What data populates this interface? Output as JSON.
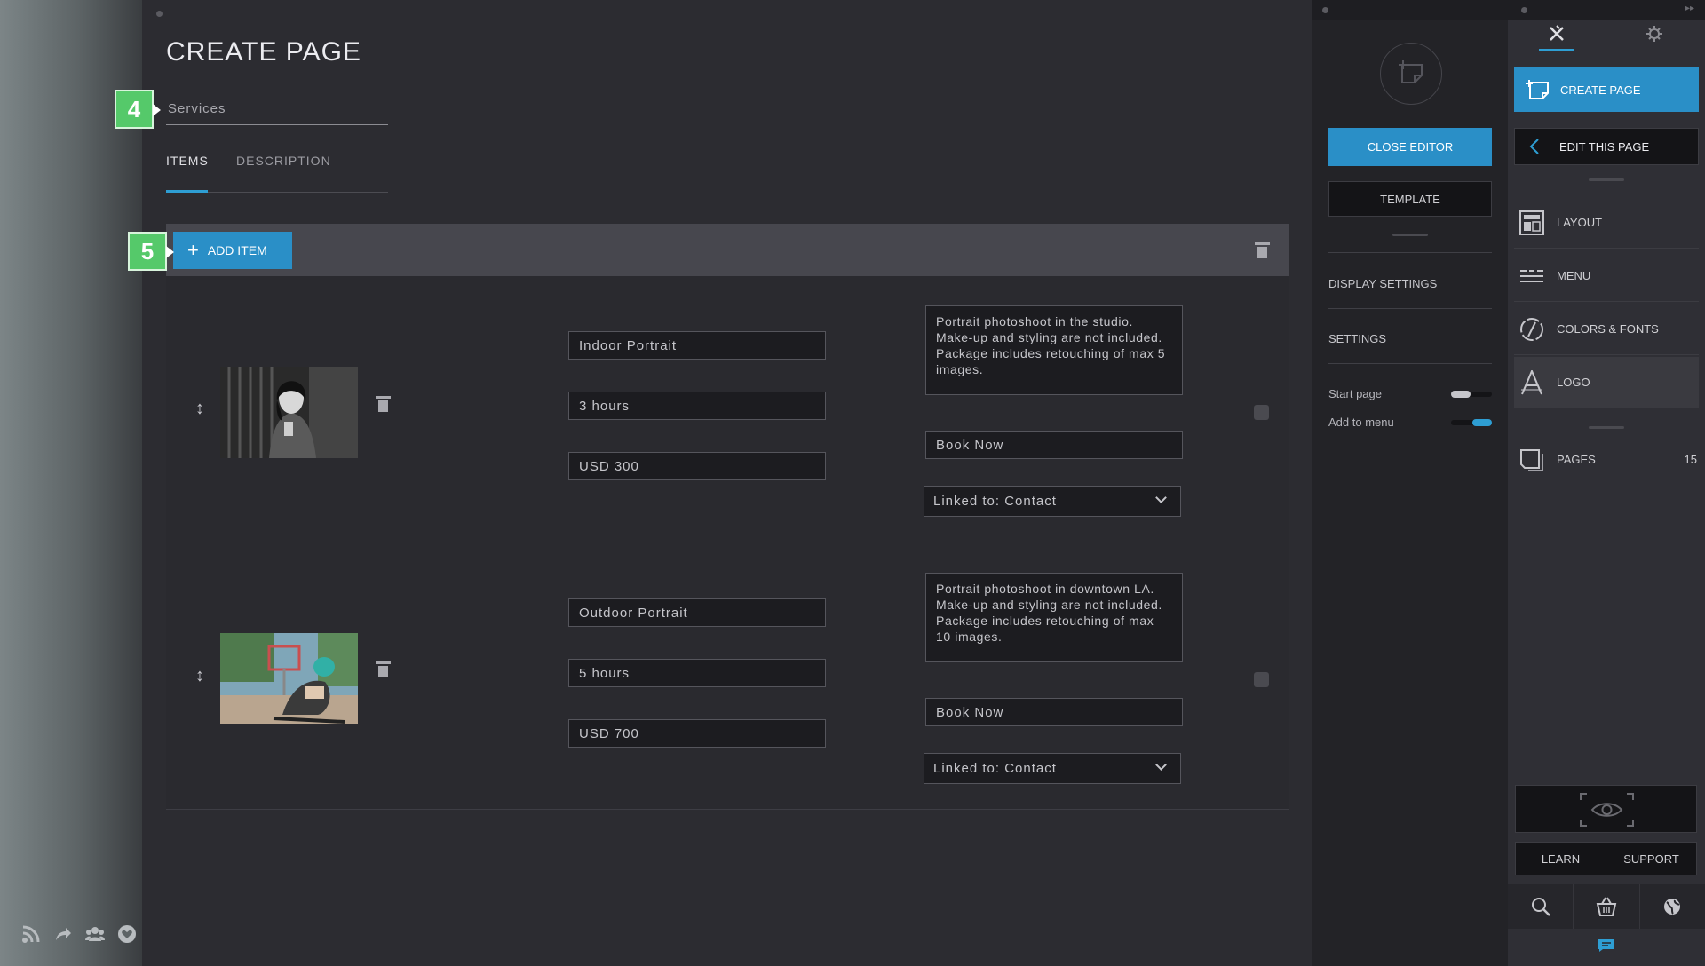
{
  "editor": {
    "title": "CREATE PAGE",
    "page_name": "Services",
    "tabs": [
      "ITEMS",
      "DESCRIPTION"
    ],
    "active_tab": "ITEMS",
    "add_item_label": "ADD ITEM",
    "step_badges": [
      "4",
      "5"
    ],
    "items": [
      {
        "name": "Indoor Portrait",
        "duration": "3 hours",
        "price": "USD 300",
        "description": "Portrait photoshoot in the studio. Make-up and styling are not included. Package includes retouching of max 5 images.",
        "button_text": "Book Now",
        "link": "Linked to: Contact"
      },
      {
        "name": "Outdoor Portrait",
        "duration": "5 hours",
        "price": "USD 700",
        "description": "Portrait photoshoot in downtown LA. Make-up and styling are not included. Package includes retouching of max 10 images.",
        "button_text": "Book Now",
        "link": "Linked to: Contact"
      }
    ]
  },
  "settings_panel": {
    "close_editor": "CLOSE EDITOR",
    "template": "TEMPLATE",
    "display_settings": "DISPLAY SETTINGS",
    "settings": "SETTINGS",
    "start_page": "Start page",
    "add_to_menu": "Add to menu",
    "start_page_on": false,
    "add_to_menu_on": true
  },
  "tools_panel": {
    "create_page": "CREATE PAGE",
    "edit_this_page": "EDIT THIS PAGE",
    "menu": [
      {
        "label": "LAYOUT",
        "icon": "layout-icon"
      },
      {
        "label": "MENU",
        "icon": "menu-icon"
      },
      {
        "label": "COLORS & FONTS",
        "icon": "palette-icon"
      },
      {
        "label": "LOGO",
        "icon": "logo-icon"
      }
    ],
    "pages_label": "PAGES",
    "pages_count": "15",
    "learn": "LEARN",
    "support": "SUPPORT"
  },
  "colors": {
    "accent": "#2a8fc7",
    "badge": "#55c96a",
    "background": "#2c2c31"
  }
}
